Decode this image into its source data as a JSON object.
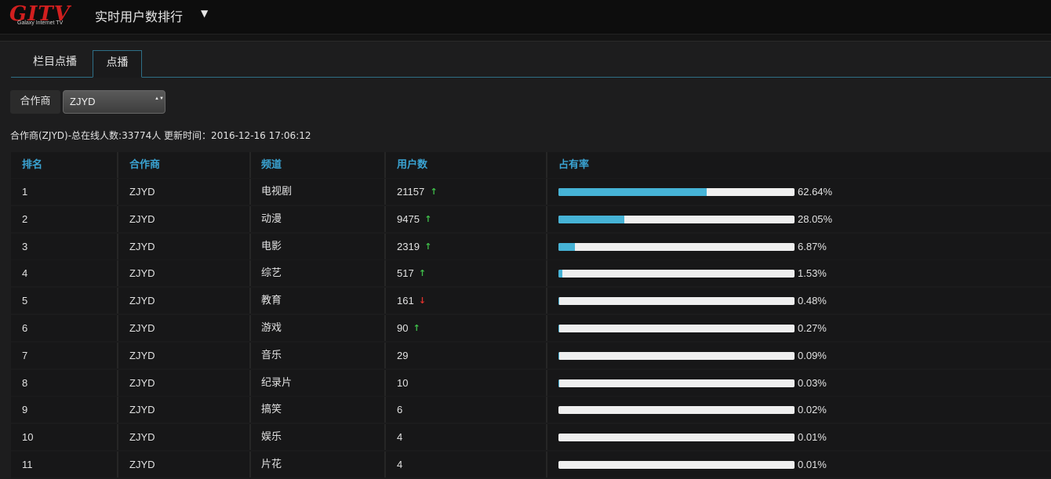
{
  "header": {
    "logo_text": "GITV",
    "logo_subtext": "Galaxy Internet TV",
    "title": "实时用户数排行",
    "title_caret": "▼"
  },
  "tabs": [
    {
      "label": "栏目点播",
      "active": false
    },
    {
      "label": "点播",
      "active": true
    }
  ],
  "filter": {
    "label": "合作商",
    "selected": "ZJYD",
    "arrows": "▲▼"
  },
  "summary": "合作商(ZJYD)-总在线人数:33774人 更新时间：2016-12-16 17:06:12",
  "table": {
    "columns": [
      "排名",
      "合作商",
      "频道",
      "用户数",
      "占有率"
    ],
    "rows": [
      {
        "rank": "1",
        "partner": "ZJYD",
        "channel": "电视剧",
        "users": "21157",
        "trend": "up",
        "share": 62.64,
        "share_label": "62.64%"
      },
      {
        "rank": "2",
        "partner": "ZJYD",
        "channel": "动漫",
        "users": "9475",
        "trend": "up",
        "share": 28.05,
        "share_label": "28.05%"
      },
      {
        "rank": "3",
        "partner": "ZJYD",
        "channel": "电影",
        "users": "2319",
        "trend": "up",
        "share": 6.87,
        "share_label": "6.87%"
      },
      {
        "rank": "4",
        "partner": "ZJYD",
        "channel": "综艺",
        "users": "517",
        "trend": "up",
        "share": 1.53,
        "share_label": "1.53%"
      },
      {
        "rank": "5",
        "partner": "ZJYD",
        "channel": "教育",
        "users": "161",
        "trend": "down",
        "share": 0.48,
        "share_label": "0.48%"
      },
      {
        "rank": "6",
        "partner": "ZJYD",
        "channel": "游戏",
        "users": "90",
        "trend": "up",
        "share": 0.27,
        "share_label": "0.27%"
      },
      {
        "rank": "7",
        "partner": "ZJYD",
        "channel": "音乐",
        "users": "29",
        "trend": "",
        "share": 0.09,
        "share_label": "0.09%"
      },
      {
        "rank": "8",
        "partner": "ZJYD",
        "channel": "纪录片",
        "users": "10",
        "trend": "",
        "share": 0.03,
        "share_label": "0.03%"
      },
      {
        "rank": "9",
        "partner": "ZJYD",
        "channel": "搞笑",
        "users": "6",
        "trend": "",
        "share": 0.02,
        "share_label": "0.02%"
      },
      {
        "rank": "10",
        "partner": "ZJYD",
        "channel": "娱乐",
        "users": "4",
        "trend": "",
        "share": 0.01,
        "share_label": "0.01%"
      },
      {
        "rank": "11",
        "partner": "ZJYD",
        "channel": "片花",
        "users": "4",
        "trend": "",
        "share": 0.01,
        "share_label": "0.01%"
      }
    ]
  },
  "colors": {
    "accent": "#3aa3d2",
    "bar_fill": "#46b3d6",
    "trend_up": "#3fbf4a",
    "trend_down": "#e0312c",
    "brand_red": "#d21f1f"
  },
  "icons": {
    "trend_up": "↑",
    "trend_down": "↓"
  }
}
